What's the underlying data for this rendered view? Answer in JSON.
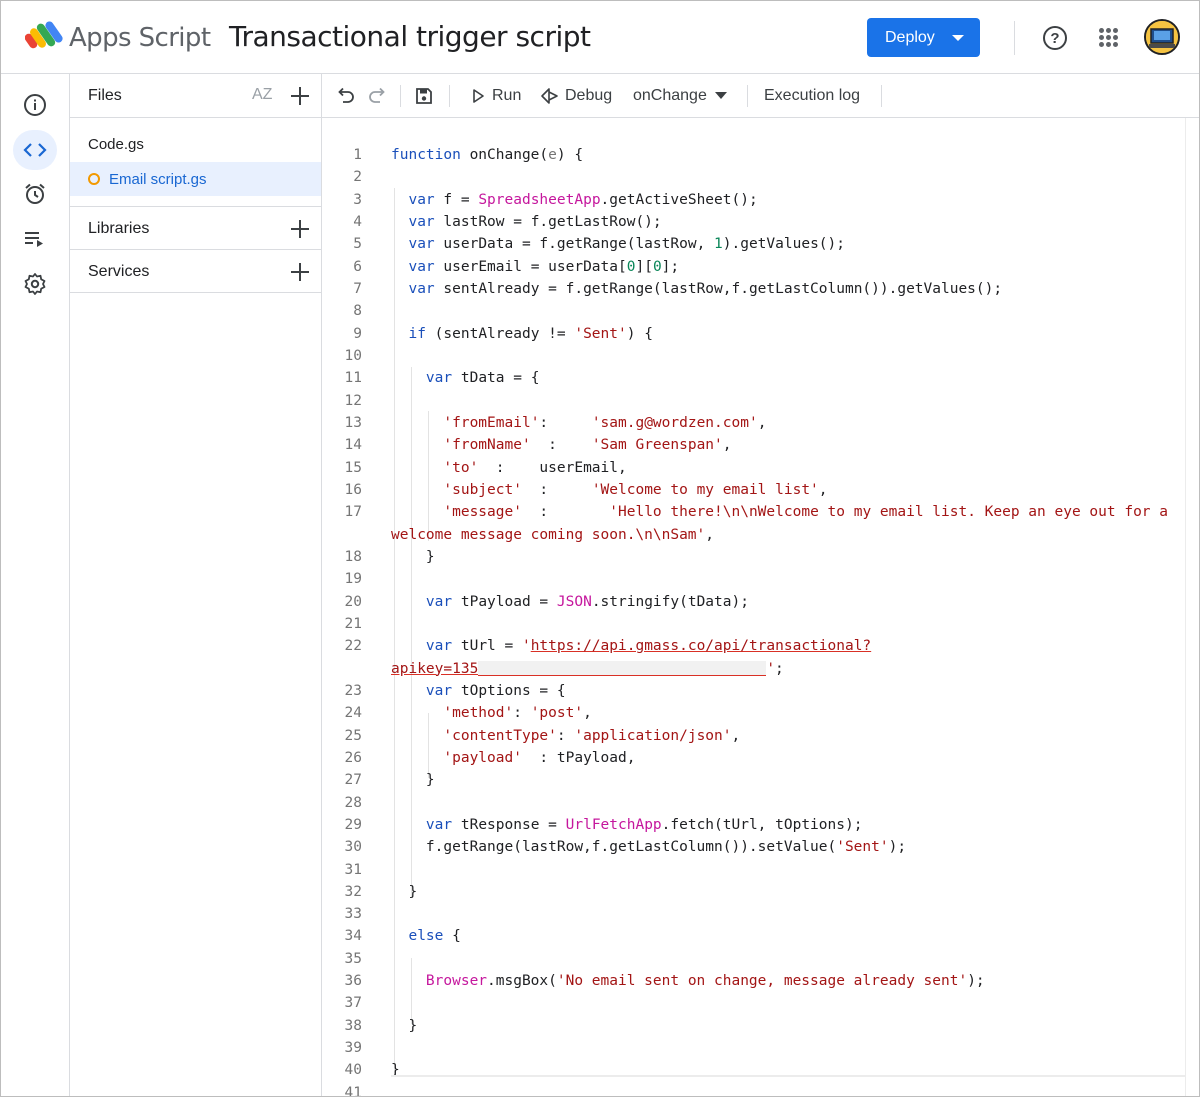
{
  "header": {
    "app_name": "Apps Script",
    "project_title": "Transactional trigger script",
    "deploy_label": "Deploy",
    "help_glyph": "?",
    "colors": {
      "deploy_blue": "#1a73e8",
      "active_blue": "#1967d2"
    }
  },
  "rail": {
    "items": [
      {
        "icon": "info-icon"
      },
      {
        "icon": "code-icon",
        "active": true
      },
      {
        "icon": "alarm-icon"
      },
      {
        "icon": "executions-icon"
      },
      {
        "icon": "gear-icon"
      }
    ]
  },
  "files_panel": {
    "title": "Files",
    "sort_glyph": "AZ",
    "files": [
      {
        "name": "Code.gs"
      },
      {
        "name": "Email script.gs",
        "active": true,
        "unsaved": true
      }
    ],
    "libraries_label": "Libraries",
    "services_label": "Services"
  },
  "toolbar": {
    "run_label": "Run",
    "debug_label": "Debug",
    "function_select": "onChange",
    "execution_log_label": "Execution log"
  },
  "editor": {
    "line_numbers": [
      "1",
      "2",
      "3",
      "4",
      "5",
      "6",
      "7",
      "8",
      "9",
      "10",
      "11",
      "12",
      "13",
      "14",
      "15",
      "16",
      "17",
      "",
      "18",
      "19",
      "20",
      "21",
      "22",
      "",
      "23",
      "24",
      "25",
      "26",
      "27",
      "28",
      "29",
      "30",
      "31",
      "32",
      "33",
      "34",
      "35",
      "36",
      "37",
      "38",
      "39",
      "40",
      "41"
    ],
    "code": {
      "l1": "function onChange(e) {",
      "l3": "var f = SpreadsheetApp.getActiveSheet();",
      "l4": "var lastRow = f.getLastRow();",
      "l5": "var userData = f.getRange(lastRow, 1).getValues();",
      "l6": "var userEmail = userData[0][0];",
      "l7": "var sentAlready = f.getRange(lastRow,f.getLastColumn()).getValues();",
      "l9": "if (sentAlready != 'Sent') {",
      "l11": "var tData = {",
      "l13": "'fromEmail':     'sam.g@wordzen.com',",
      "l14": "'fromName'  :    'Sam Greenspan',",
      "l15": "'to'  :    userEmail,",
      "l16": "'subject'  :     'Welcome to my email list',",
      "l17": "'message'  :       'Hello there!\\n\\nWelcome to my email list. Keep an eye out for a",
      "l17b": "welcome message coming soon.\\n\\nSam',",
      "l18": "}",
      "l20": "var tPayload = JSON.stringify(tData);",
      "l22": "var tUrl = 'https://api.gmass.co/api/transactional?",
      "l22b": "apikey=135",
      "l22c": "';",
      "l23": "var tOptions = {",
      "l24": "'method': 'post',",
      "l25": "'contentType': 'application/json',",
      "l26": "'payload'  : tPayload,",
      "l27": "}",
      "l29": "var tResponse = UrlFetchApp.fetch(tUrl, tOptions);",
      "l30": "f.getRange(lastRow,f.getLastColumn()).setValue('Sent');",
      "l32": "}",
      "l34": "else {",
      "l36": "Browser.msgBox('No email sent on change, message already sent');",
      "l38": "}",
      "l40": "}"
    }
  }
}
